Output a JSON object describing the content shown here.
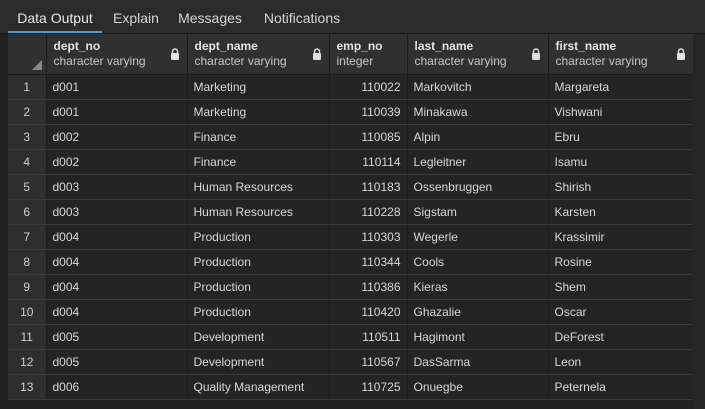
{
  "tabs": [
    {
      "label": "Data Output",
      "active": true
    },
    {
      "label": "Explain",
      "active": false
    },
    {
      "label": "Messages",
      "active": false
    },
    {
      "label": "Notifications",
      "active": false
    }
  ],
  "columns": [
    {
      "name": "dept_no",
      "type": "character varying"
    },
    {
      "name": "dept_name",
      "type": "character varying"
    },
    {
      "name": "emp_no",
      "type": "integer"
    },
    {
      "name": "last_name",
      "type": "character varying"
    },
    {
      "name": "first_name",
      "type": "character varying"
    }
  ],
  "rows": [
    {
      "n": "1",
      "dept_no": "d001",
      "dept_name": "Marketing",
      "emp_no": "110022",
      "last_name": "Markovitch",
      "first_name": "Margareta"
    },
    {
      "n": "2",
      "dept_no": "d001",
      "dept_name": "Marketing",
      "emp_no": "110039",
      "last_name": "Minakawa",
      "first_name": "Vishwani"
    },
    {
      "n": "3",
      "dept_no": "d002",
      "dept_name": "Finance",
      "emp_no": "110085",
      "last_name": "Alpin",
      "first_name": "Ebru"
    },
    {
      "n": "4",
      "dept_no": "d002",
      "dept_name": "Finance",
      "emp_no": "110114",
      "last_name": "Legleitner",
      "first_name": "Isamu"
    },
    {
      "n": "5",
      "dept_no": "d003",
      "dept_name": "Human Resources",
      "emp_no": "110183",
      "last_name": "Ossenbruggen",
      "first_name": "Shirish"
    },
    {
      "n": "6",
      "dept_no": "d003",
      "dept_name": "Human Resources",
      "emp_no": "110228",
      "last_name": "Sigstam",
      "first_name": "Karsten"
    },
    {
      "n": "7",
      "dept_no": "d004",
      "dept_name": "Production",
      "emp_no": "110303",
      "last_name": "Wegerle",
      "first_name": "Krassimir"
    },
    {
      "n": "8",
      "dept_no": "d004",
      "dept_name": "Production",
      "emp_no": "110344",
      "last_name": "Cools",
      "first_name": "Rosine"
    },
    {
      "n": "9",
      "dept_no": "d004",
      "dept_name": "Production",
      "emp_no": "110386",
      "last_name": "Kieras",
      "first_name": "Shem"
    },
    {
      "n": "10",
      "dept_no": "d004",
      "dept_name": "Production",
      "emp_no": "110420",
      "last_name": "Ghazalie",
      "first_name": "Oscar"
    },
    {
      "n": "11",
      "dept_no": "d005",
      "dept_name": "Development",
      "emp_no": "110511",
      "last_name": "Hagimont",
      "first_name": "DeForest"
    },
    {
      "n": "12",
      "dept_no": "d005",
      "dept_name": "Development",
      "emp_no": "110567",
      "last_name": "DasSarma",
      "first_name": "Leon"
    },
    {
      "n": "13",
      "dept_no": "d006",
      "dept_name": "Quality Management",
      "emp_no": "110725",
      "last_name": "Onuegbe",
      "first_name": "Peternela"
    }
  ],
  "colors": {
    "background": "#222222",
    "header": "#303030",
    "tab_accent": "#4a9ce0"
  },
  "icons": {
    "column_lock": "lock-icon",
    "select_all": "select-all-corner-icon"
  }
}
